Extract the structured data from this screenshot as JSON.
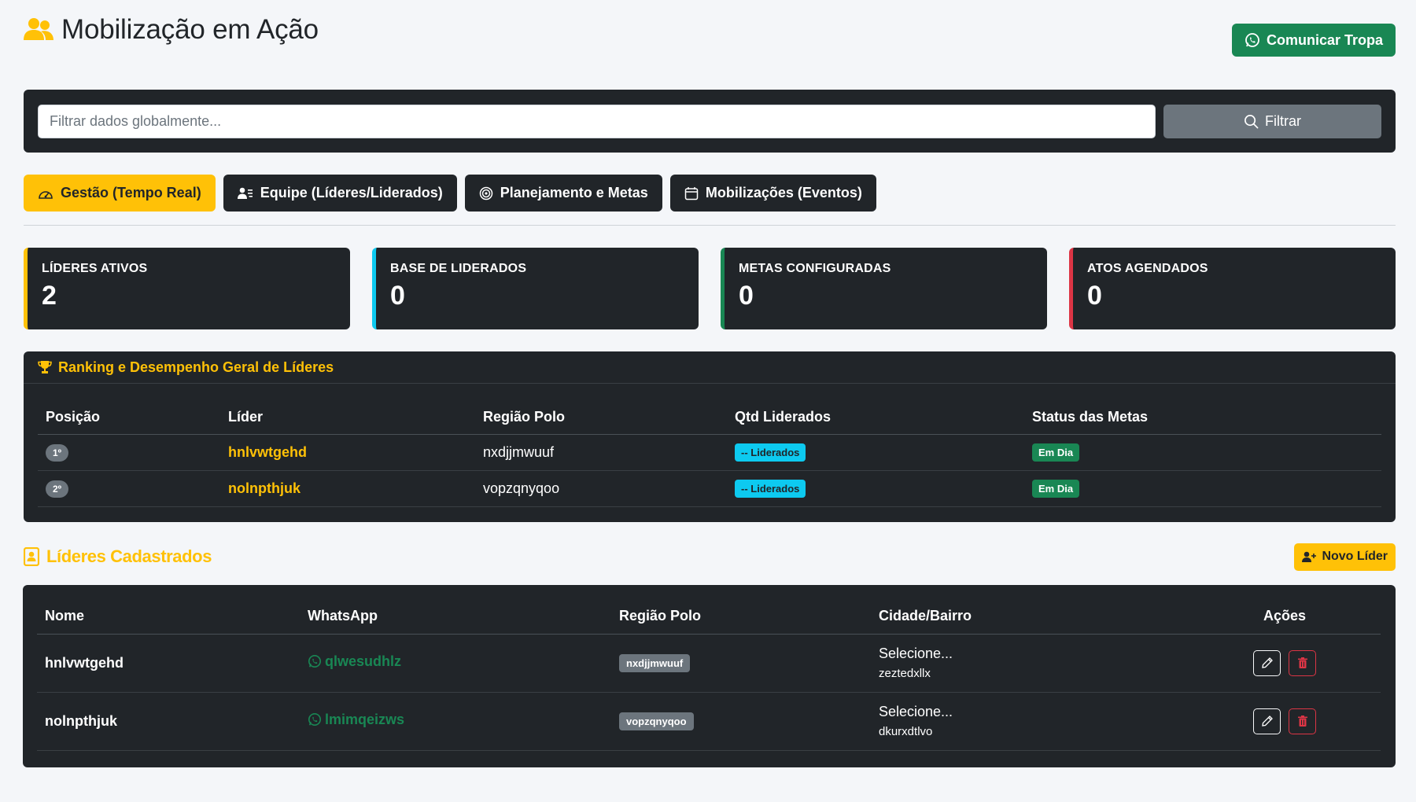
{
  "header": {
    "title": "Mobilização em Ação",
    "communicate_label": "Comunicar Tropa"
  },
  "filter": {
    "placeholder": "Filtrar dados globalmente...",
    "button_label": "Filtrar"
  },
  "tabs": [
    {
      "label": "Gestão (Tempo Real)",
      "active": true
    },
    {
      "label": "Equipe (Líderes/Liderados)",
      "active": false
    },
    {
      "label": "Planejamento e Metas",
      "active": false
    },
    {
      "label": "Mobilizações (Eventos)",
      "active": false
    }
  ],
  "stats": [
    {
      "label": "LÍDERES ATIVOS",
      "value": "2",
      "color": "#ffc107"
    },
    {
      "label": "BASE DE LIDERADOS",
      "value": "0",
      "color": "#0dcaf0"
    },
    {
      "label": "METAS CONFIGURADAS",
      "value": "0",
      "color": "#198754"
    },
    {
      "label": "ATOS AGENDADOS",
      "value": "0",
      "color": "#dc3545"
    }
  ],
  "ranking": {
    "title": "Ranking e Desempenho Geral de Líderes",
    "columns": [
      "Posição",
      "Líder",
      "Região Polo",
      "Qtd Liderados",
      "Status das Metas"
    ],
    "rows": [
      {
        "position": "1º",
        "leader": "hnlvwtgehd",
        "region": "nxdjjmwuuf",
        "qty": "-- Liderados",
        "status": "Em Dia"
      },
      {
        "position": "2º",
        "leader": "nolnpthjuk",
        "region": "vopzqnyqoo",
        "qty": "-- Liderados",
        "status": "Em Dia"
      }
    ]
  },
  "leaders": {
    "title": "Líderes Cadastrados",
    "new_label": "Novo Líder",
    "columns": [
      "Nome",
      "WhatsApp",
      "Região Polo",
      "Cidade/Bairro",
      "Ações"
    ],
    "rows": [
      {
        "name": "hnlvwtgehd",
        "whatsapp": "qlwesudhlz",
        "region": "nxdjjmwuuf",
        "city": "Selecione...",
        "neighborhood": "zeztedxllx"
      },
      {
        "name": "nolnpthjuk",
        "whatsapp": "lmimqeizws",
        "region": "vopzqnyqoo",
        "city": "Selecione...",
        "neighborhood": "dkurxdtlvo"
      }
    ]
  },
  "colors": {
    "accent": "#ffc107",
    "dark": "#212529",
    "success": "#198754",
    "info": "#0dcaf0",
    "danger": "#dc3545",
    "secondary": "#6c757d"
  }
}
